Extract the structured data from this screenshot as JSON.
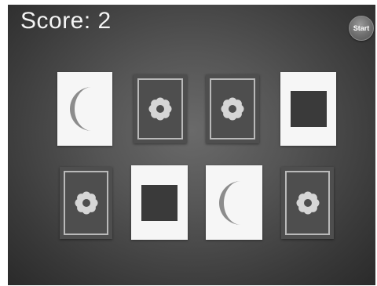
{
  "score": {
    "text": "Score: 2"
  },
  "start_button": {
    "label": "Start"
  },
  "colors": {
    "card_face": "#f6f6f6",
    "card_back": "#4e4e4e",
    "card_back_frame": "#b9b9b9",
    "moon": "#8c8c8c",
    "flower": "#d6d6d6",
    "square": "#3a3a3a",
    "text": "#f4f4f4"
  },
  "cards": [
    {
      "row": 1,
      "col": 1,
      "state": "face-up",
      "symbol": "moon-icon"
    },
    {
      "row": 1,
      "col": 2,
      "state": "face-down",
      "symbol": "flower-icon"
    },
    {
      "row": 1,
      "col": 3,
      "state": "face-down",
      "symbol": "flower-icon"
    },
    {
      "row": 1,
      "col": 4,
      "state": "face-up",
      "symbol": "square-icon"
    },
    {
      "row": 2,
      "col": 1,
      "state": "face-down",
      "symbol": "flower-icon"
    },
    {
      "row": 2,
      "col": 2,
      "state": "face-up",
      "symbol": "square-icon"
    },
    {
      "row": 2,
      "col": 3,
      "state": "face-up",
      "symbol": "moon-icon"
    },
    {
      "row": 2,
      "col": 4,
      "state": "face-down",
      "symbol": "flower-icon"
    }
  ]
}
